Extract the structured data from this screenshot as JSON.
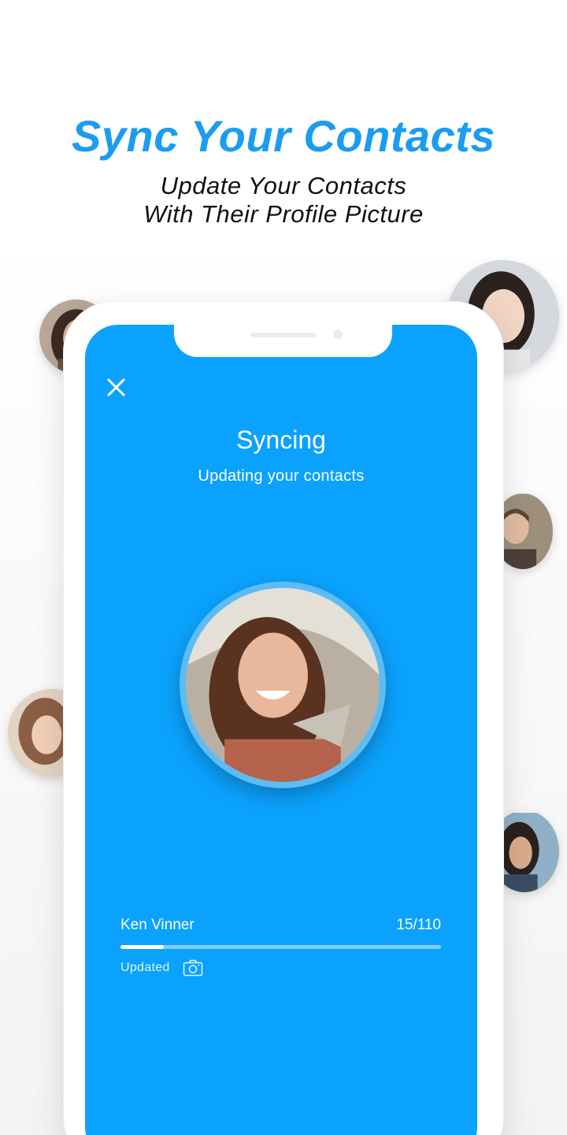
{
  "promo": {
    "headline": "Sync Your Contacts",
    "subheadline_line1": "Update Your Contacts",
    "subheadline_line2": "With Their Profile Picture"
  },
  "sync_screen": {
    "close_icon": "close-icon",
    "title": "Syncing",
    "subtitle": "Updating your contacts",
    "current_contact_name": "Ken Vinner",
    "progress_text": "15/110",
    "progress_fraction": 0.136,
    "status_label": "Updated",
    "status_icon": "camera-icon"
  },
  "colors": {
    "accent": "#1a9df0",
    "screen_background": "#0ba2fd"
  }
}
